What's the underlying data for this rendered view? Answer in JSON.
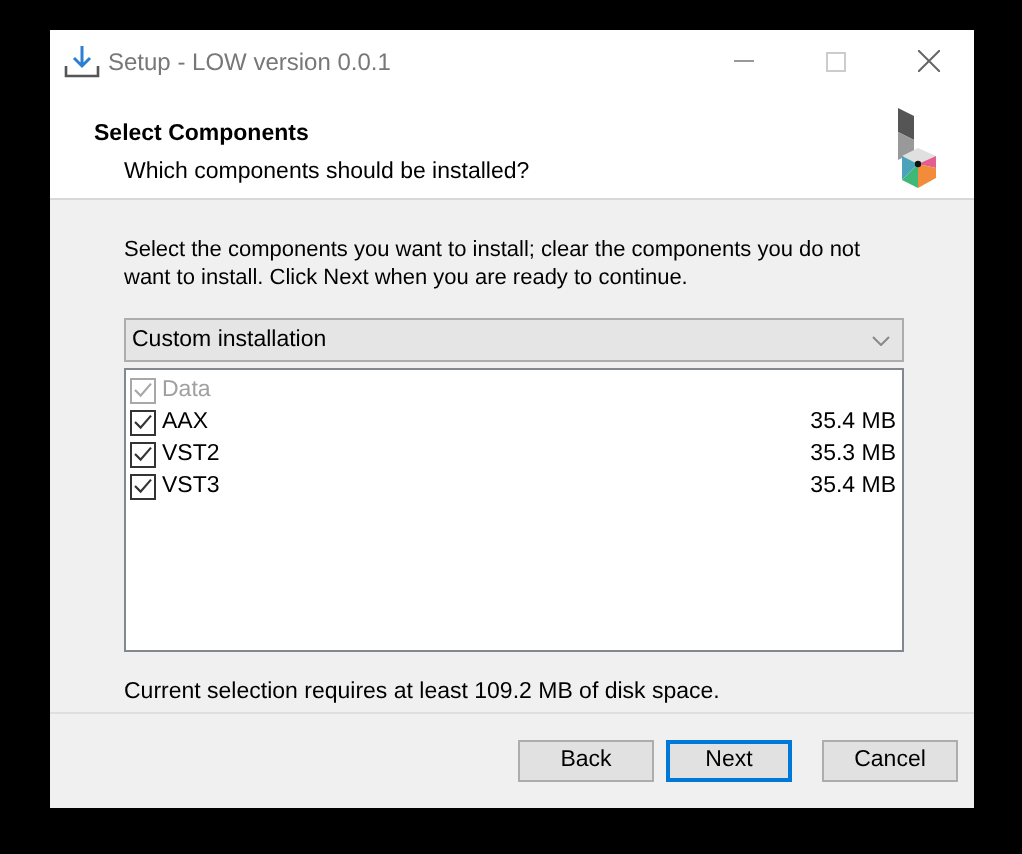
{
  "window": {
    "title": "Setup - LOW version 0.0.1"
  },
  "header": {
    "title": "Select Components",
    "subtitle": "Which components should be installed?"
  },
  "instructions": "Select the components you want to install; clear the components you do not want to install. Click Next when you are ready to continue.",
  "install_type": {
    "value": "Custom installation"
  },
  "components": [
    {
      "name": "Data",
      "checked": true,
      "disabled": true
    },
    {
      "name": "AAX",
      "checked": true,
      "disabled": false,
      "size": "35.4 MB"
    },
    {
      "name": "VST2",
      "checked": true,
      "disabled": false,
      "size": "35.3 MB"
    },
    {
      "name": "VST3",
      "checked": true,
      "disabled": false,
      "size": "35.4 MB"
    }
  ],
  "disk_space": "Current selection requires at least 109.2 MB of disk space.",
  "buttons": [
    {
      "label": "Back",
      "default": false
    },
    {
      "label": "Next",
      "default": true
    },
    {
      "label": "Cancel",
      "default": false
    }
  ]
}
